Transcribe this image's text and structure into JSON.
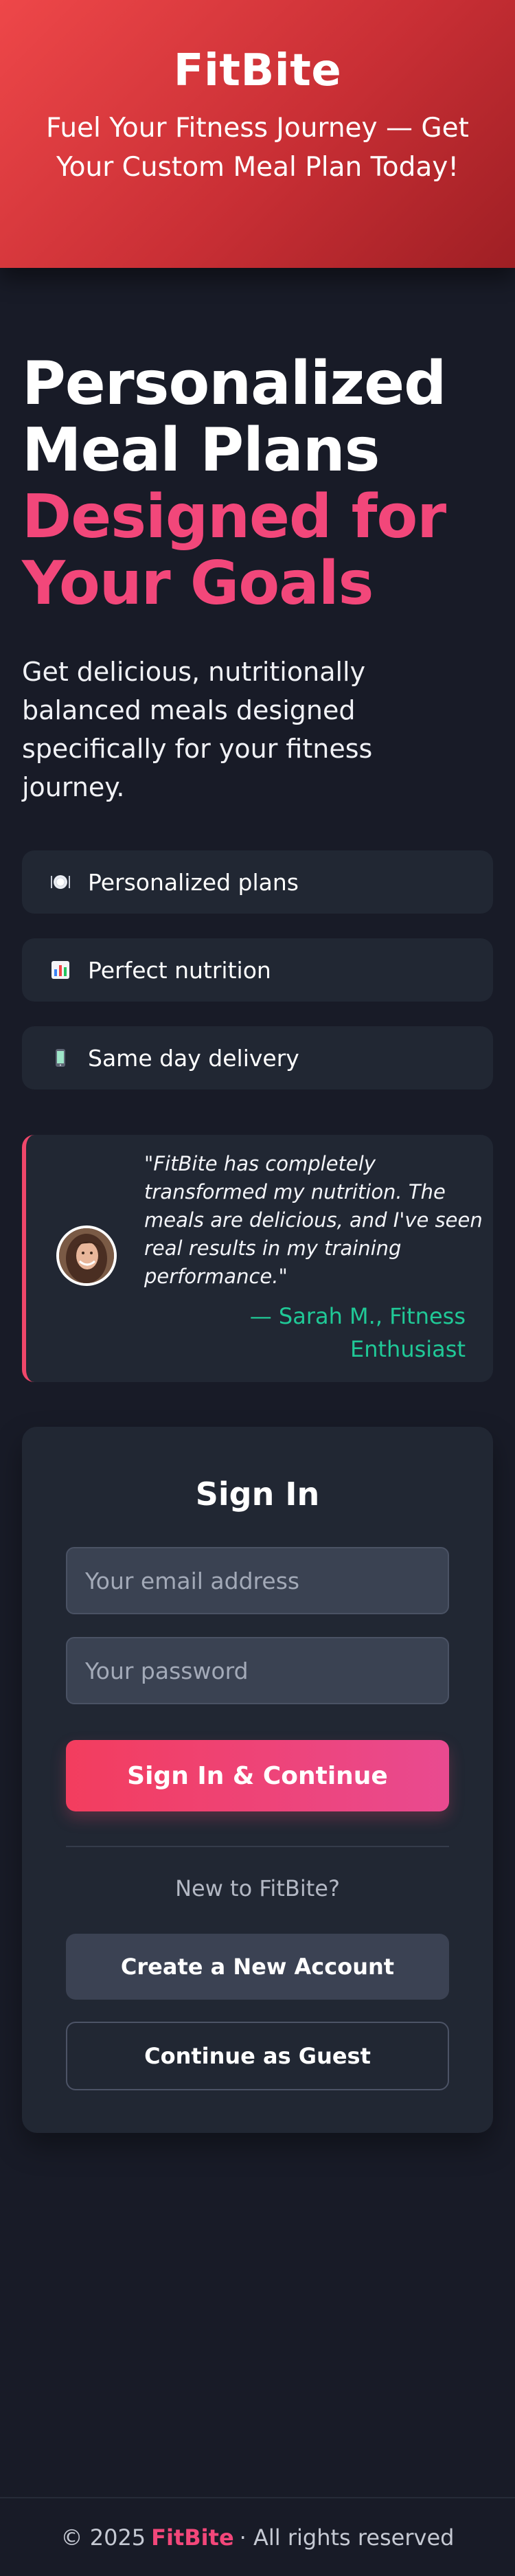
{
  "header": {
    "brand": "FitBite",
    "tagline": "Fuel Your Fitness Journey — Get Your Custom Meal Plan Today!"
  },
  "hero": {
    "title_line1": "Personalized",
    "title_line2": "Meal Plans",
    "title_line3": "Designed for",
    "title_line4": "Your Goals",
    "description": "Get delicious, nutritionally balanced meals designed specifically for your fitness journey."
  },
  "features": [
    {
      "icon": "plate-icon",
      "label": "Personalized plans"
    },
    {
      "icon": "bar-chart-icon",
      "label": "Perfect nutrition"
    },
    {
      "icon": "phone-icon",
      "label": "Same day delivery"
    }
  ],
  "testimonial": {
    "quote": "\"FitBite has completely transformed my nutrition. The meals are delicious, and I've seen real results in my training performance.\"",
    "author": "— Sarah M., Fitness Enthusiast"
  },
  "signin": {
    "title": "Sign In",
    "email_placeholder": "Your email address",
    "password_placeholder": "Your password",
    "submit_label": "Sign In & Continue",
    "new_prompt": "New to FitBite?",
    "create_label": "Create a New Account",
    "guest_label": "Continue as Guest"
  },
  "footer": {
    "prefix": "© 2025",
    "brand": "FitBite",
    "suffix": "· All rights reserved"
  },
  "colors": {
    "header_gradient_start": "#ee4749",
    "header_gradient_end": "#9f1f24",
    "accent_pink": "#f2477a",
    "accent_green": "#20c997",
    "background": "#181b27",
    "card": "#212733"
  }
}
